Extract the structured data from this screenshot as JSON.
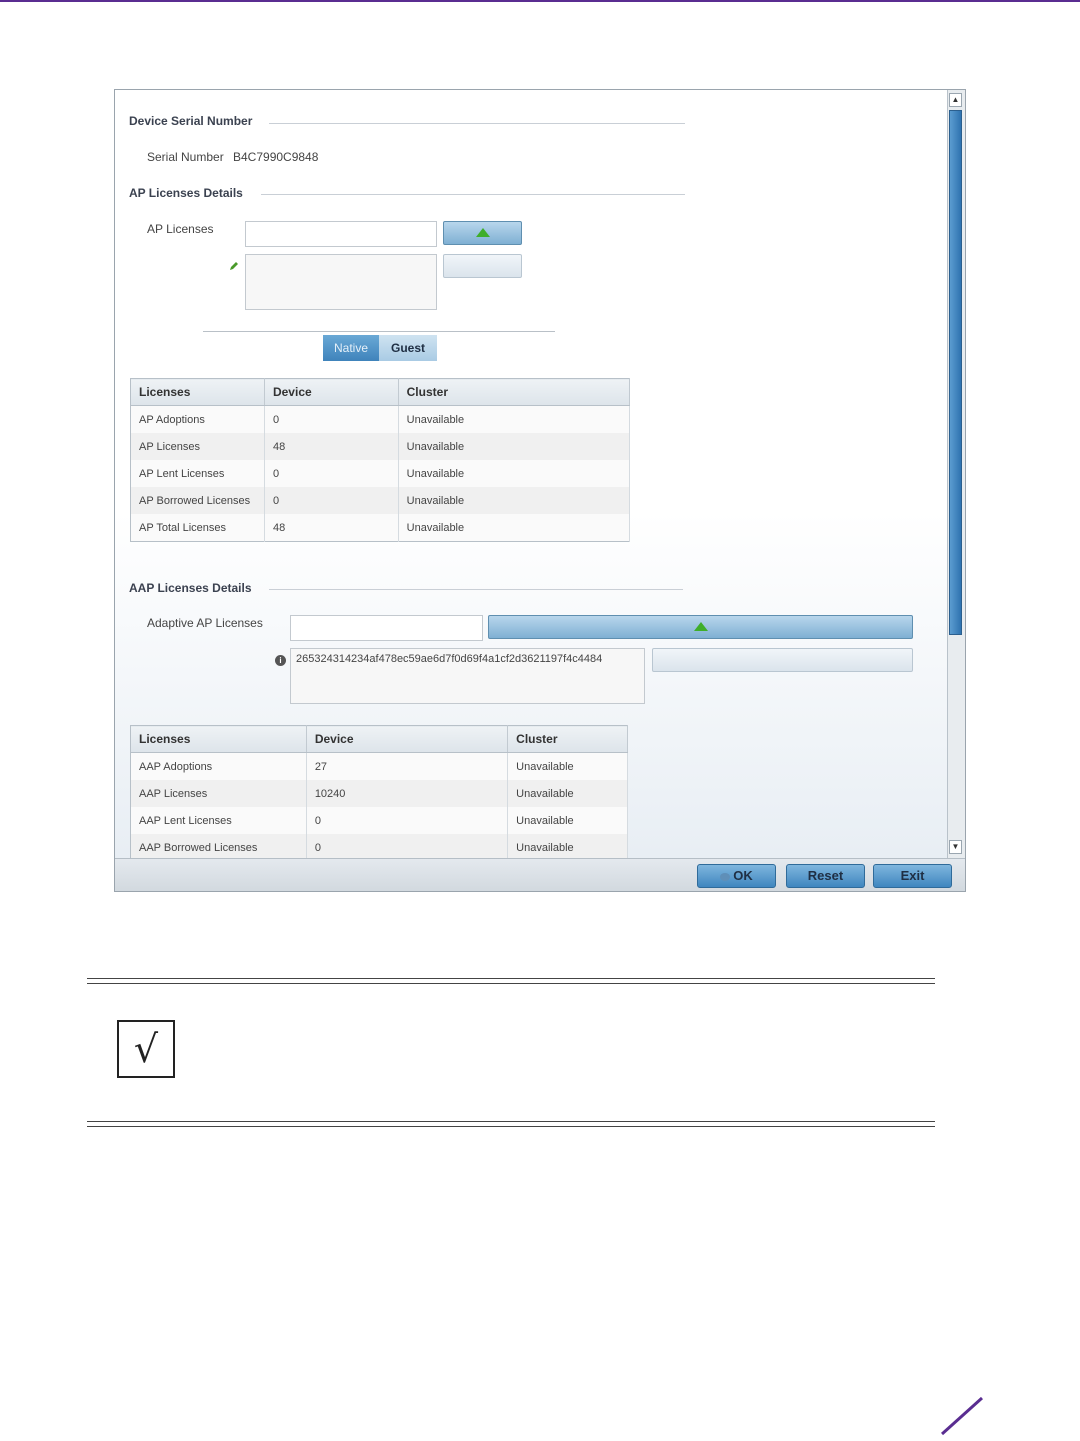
{
  "device_serial": {
    "section_title": "Device Serial Number",
    "label": "Serial Number",
    "value": "B4C7990C9848"
  },
  "ap_licenses": {
    "section_title": "AP Licenses Details",
    "field_label": "AP Licenses",
    "tabs": [
      "Native",
      "Guest"
    ],
    "table": {
      "headers": [
        "Licenses",
        "Device",
        "Cluster"
      ],
      "rows": [
        [
          "AP Adoptions",
          "0",
          "Unavailable"
        ],
        [
          "AP Licenses",
          "48",
          "Unavailable"
        ],
        [
          "AP Lent Licenses",
          "0",
          "Unavailable"
        ],
        [
          "AP Borrowed Licenses",
          "0",
          "Unavailable"
        ],
        [
          "AP Total Licenses",
          "48",
          "Unavailable"
        ]
      ]
    }
  },
  "aap_licenses": {
    "section_title": "AAP Licenses Details",
    "field_label": "Adaptive AP Licenses",
    "license_key": "265324314234af478ec59ae6d7f0d69f4a1cf2d3621197f4c4484",
    "table": {
      "headers": [
        "Licenses",
        "Device",
        "Cluster"
      ],
      "rows": [
        [
          "AAP Adoptions",
          "27",
          "Unavailable"
        ],
        [
          "AAP Licenses",
          "10240",
          "Unavailable"
        ],
        [
          "AAP Lent Licenses",
          "0",
          "Unavailable"
        ],
        [
          "AAP Borrowed Licenses",
          "0",
          "Unavailable"
        ]
      ]
    }
  },
  "footer": {
    "ok": "OK",
    "reset": "Reset",
    "exit": "Exit"
  },
  "note": {
    "icon": "check-icon",
    "glyph": "√"
  },
  "colors": {
    "brand": "#5a2d91",
    "accent_button": "#3f86bf",
    "add_arrow": "#3fae2a"
  }
}
